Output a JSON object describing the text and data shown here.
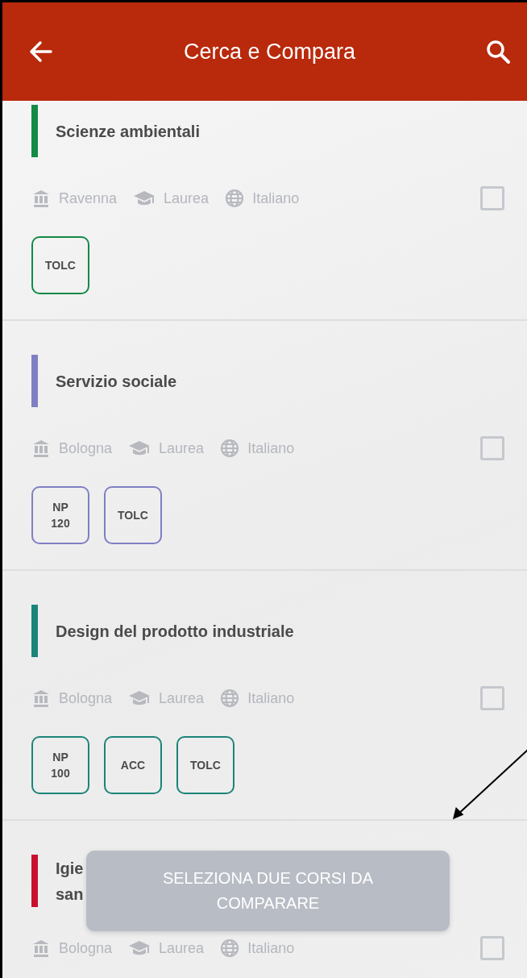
{
  "header": {
    "title": "Cerca e Compara"
  },
  "courses": [
    {
      "title": "Scienze ambientali",
      "color": "#138a45",
      "city": "Ravenna",
      "degree": "Laurea",
      "language": "Italiano",
      "checked": false,
      "tags": [
        "TOLC"
      ]
    },
    {
      "title": "Servizio sociale",
      "color": "#7f7fc4",
      "city": "Bologna",
      "degree": "Laurea",
      "language": "Italiano",
      "checked": false,
      "tags": [
        "NP\n120",
        "TOLC"
      ]
    },
    {
      "title": "Design del prodotto industriale",
      "color": "#1b8478",
      "city": "Bologna",
      "degree": "Laurea",
      "language": "Italiano",
      "checked": false,
      "tags": [
        "NP\n100",
        "ACC",
        "TOLC"
      ]
    },
    {
      "title": "Igie\nsan",
      "color": "#c8102e",
      "city": "Bologna",
      "degree": "Laurea",
      "language": "Italiano",
      "checked": false
    }
  ],
  "compare_button": {
    "label": "SELEZIONA DUE CORSI DA COMPARARE",
    "disabled": true
  }
}
